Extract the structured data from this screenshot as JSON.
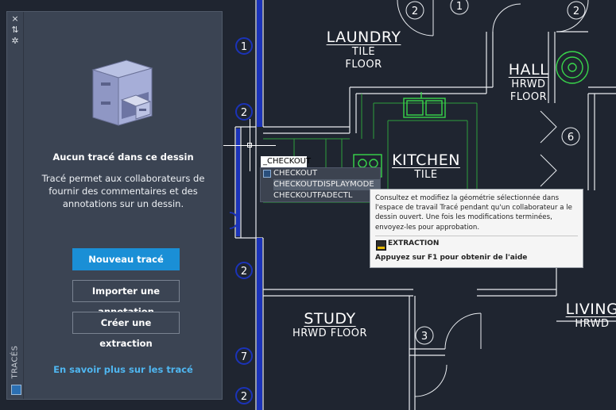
{
  "palette": {
    "strip_buttons": [
      "×",
      "⇅",
      "✲"
    ],
    "vertical_label": "TRACÉS",
    "empty_title": "Aucun tracé dans ce dessin",
    "empty_description": "Tracé permet aux collaborateurs de fournir des commentaires et des annotations sur un dessin.",
    "new_trace_button": "Nouveau tracé",
    "import_annotation_button": "Importer une annotation",
    "create_extract_button": "Créer une extraction",
    "learn_more_link": "En savoir plus sur les tracé"
  },
  "command": {
    "input_value": "_CHECKOUT",
    "suggestions": [
      "CHECKOUT",
      "CHECKOUTDISPLAYMODE",
      "CHECKOUTFADECTL"
    ]
  },
  "tooltip": {
    "description": "Consultez et modifiez la géométrie sélectionnée dans l'espace de travail Tracé pendant qu'un collaborateur a le dessin ouvert. Une fois les modifications terminées, envoyez-les pour approbation.",
    "command_name": "EXTRACTION",
    "help_hint": "Appuyez sur F1 pour obtenir de l'aide"
  },
  "drawing": {
    "rooms": [
      {
        "name": "LAUNDRY",
        "sub1": "TILE",
        "sub2": "FLOOR"
      },
      {
        "name": "HALL",
        "sub1": "HRWD",
        "sub2": "FLOOR"
      },
      {
        "name": "KITCHEN",
        "sub1": "TILE",
        "sub2": ""
      },
      {
        "name": "STUDY",
        "sub1": "HRWD  FLOOR",
        "sub2": ""
      },
      {
        "name": "LIVING",
        "sub1": "HRWD",
        "sub2": ""
      }
    ],
    "wall_tags": [
      "1",
      "2",
      "2",
      "7",
      "2"
    ],
    "door_tags": [
      "2",
      "1",
      "2",
      "6",
      "3"
    ]
  },
  "colors": {
    "background": "#1f2530",
    "wall": "#e9ecf0",
    "green": "#2ea03c",
    "bright_green": "#39d64b",
    "tag_blue": "#1b33b8",
    "accent": "#1a8fd6",
    "link": "#4fb6f0"
  }
}
